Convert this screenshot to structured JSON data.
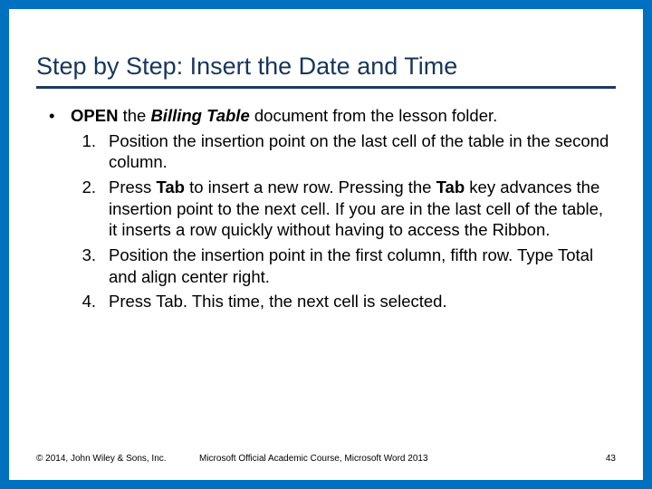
{
  "title": "Step by Step: Insert the Date and Time",
  "intro": {
    "pre": "OPEN",
    "mid": " the ",
    "doc": "Billing Table",
    "post": " document from the lesson folder."
  },
  "steps": [
    {
      "num": "1.",
      "text": "Position the insertion point on the last cell of the table in the second column."
    },
    {
      "num": "2.",
      "pre": "Press ",
      "b1": "Tab",
      "mid": " to insert a new row. Pressing the ",
      "b2": "Tab",
      "post": " key advances the insertion point to the next cell. If you are in the last cell of the table, it inserts a row quickly without having to access the Ribbon."
    },
    {
      "num": "3.",
      "text": "Position the insertion point in the first column, fifth row. Type Total and align center right."
    },
    {
      "num": "4.",
      "text": "Press Tab. This time, the next cell is selected."
    }
  ],
  "footer": {
    "left": "© 2014, John Wiley & Sons, Inc.",
    "center": "Microsoft Official Academic Course, Microsoft Word 2013",
    "right": "43"
  }
}
